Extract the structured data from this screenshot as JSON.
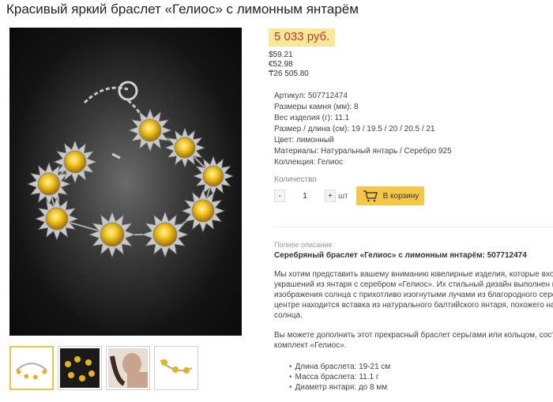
{
  "product": {
    "title": "Красивый яркий браслет «Гелиос» с лимонным янтарём"
  },
  "price": {
    "main": "5 033 руб.",
    "alt": [
      "$59.21",
      "€52.98",
      "₸26 505.80"
    ]
  },
  "specs": [
    "Артикул: 507712474",
    "Размеры камня (мм): 8",
    "Вес изделия (г): 11.1",
    "Размер / длина (см): 19 / 19.5 / 20 / 20.5 / 21",
    "Цвет: лимонный",
    "Материалы: Натуральный янтарь / Серебро 925",
    "Коллекция: Гелиос"
  ],
  "quantity": {
    "label": "Количество",
    "minus": "-",
    "value": "1",
    "plus": "+",
    "unit": "шт"
  },
  "cart": {
    "label": "В корзину"
  },
  "description": {
    "section_label": "Полное описание",
    "title": "Серебряный браслет «Гелиос» с лимонным янтарём: 507712474",
    "paragraph1": [
      "Мы хотим представить вашему вниманию ювелирные изделия, которые входят",
      "украшений из янтаря с серебром «Гелиос». Их стильный дизайн выполнен в ви",
      "изображения солнца с прихотливо изогнутыми лучами из благородного серебр",
      "центре находится вставка из натурального балтийского янтаря, похожего на м",
      "солнца."
    ],
    "paragraph2": [
      "Вы можете дополнить этот прекрасный браслет серьгами или кольцом, соста",
      "комплект «Гелиос»."
    ],
    "bullets": [
      "Длина браслета: 19-21 см",
      "Масса браслета: 11.1 г",
      "Диаметр янтаря: до 8 мм"
    ]
  },
  "colors": {
    "price_bg": "#fbe79a",
    "price_text": "#c0392b",
    "cart_button": "#f6c745",
    "amber": "#e8b21a"
  },
  "icons": {
    "cart": "cart-icon"
  }
}
